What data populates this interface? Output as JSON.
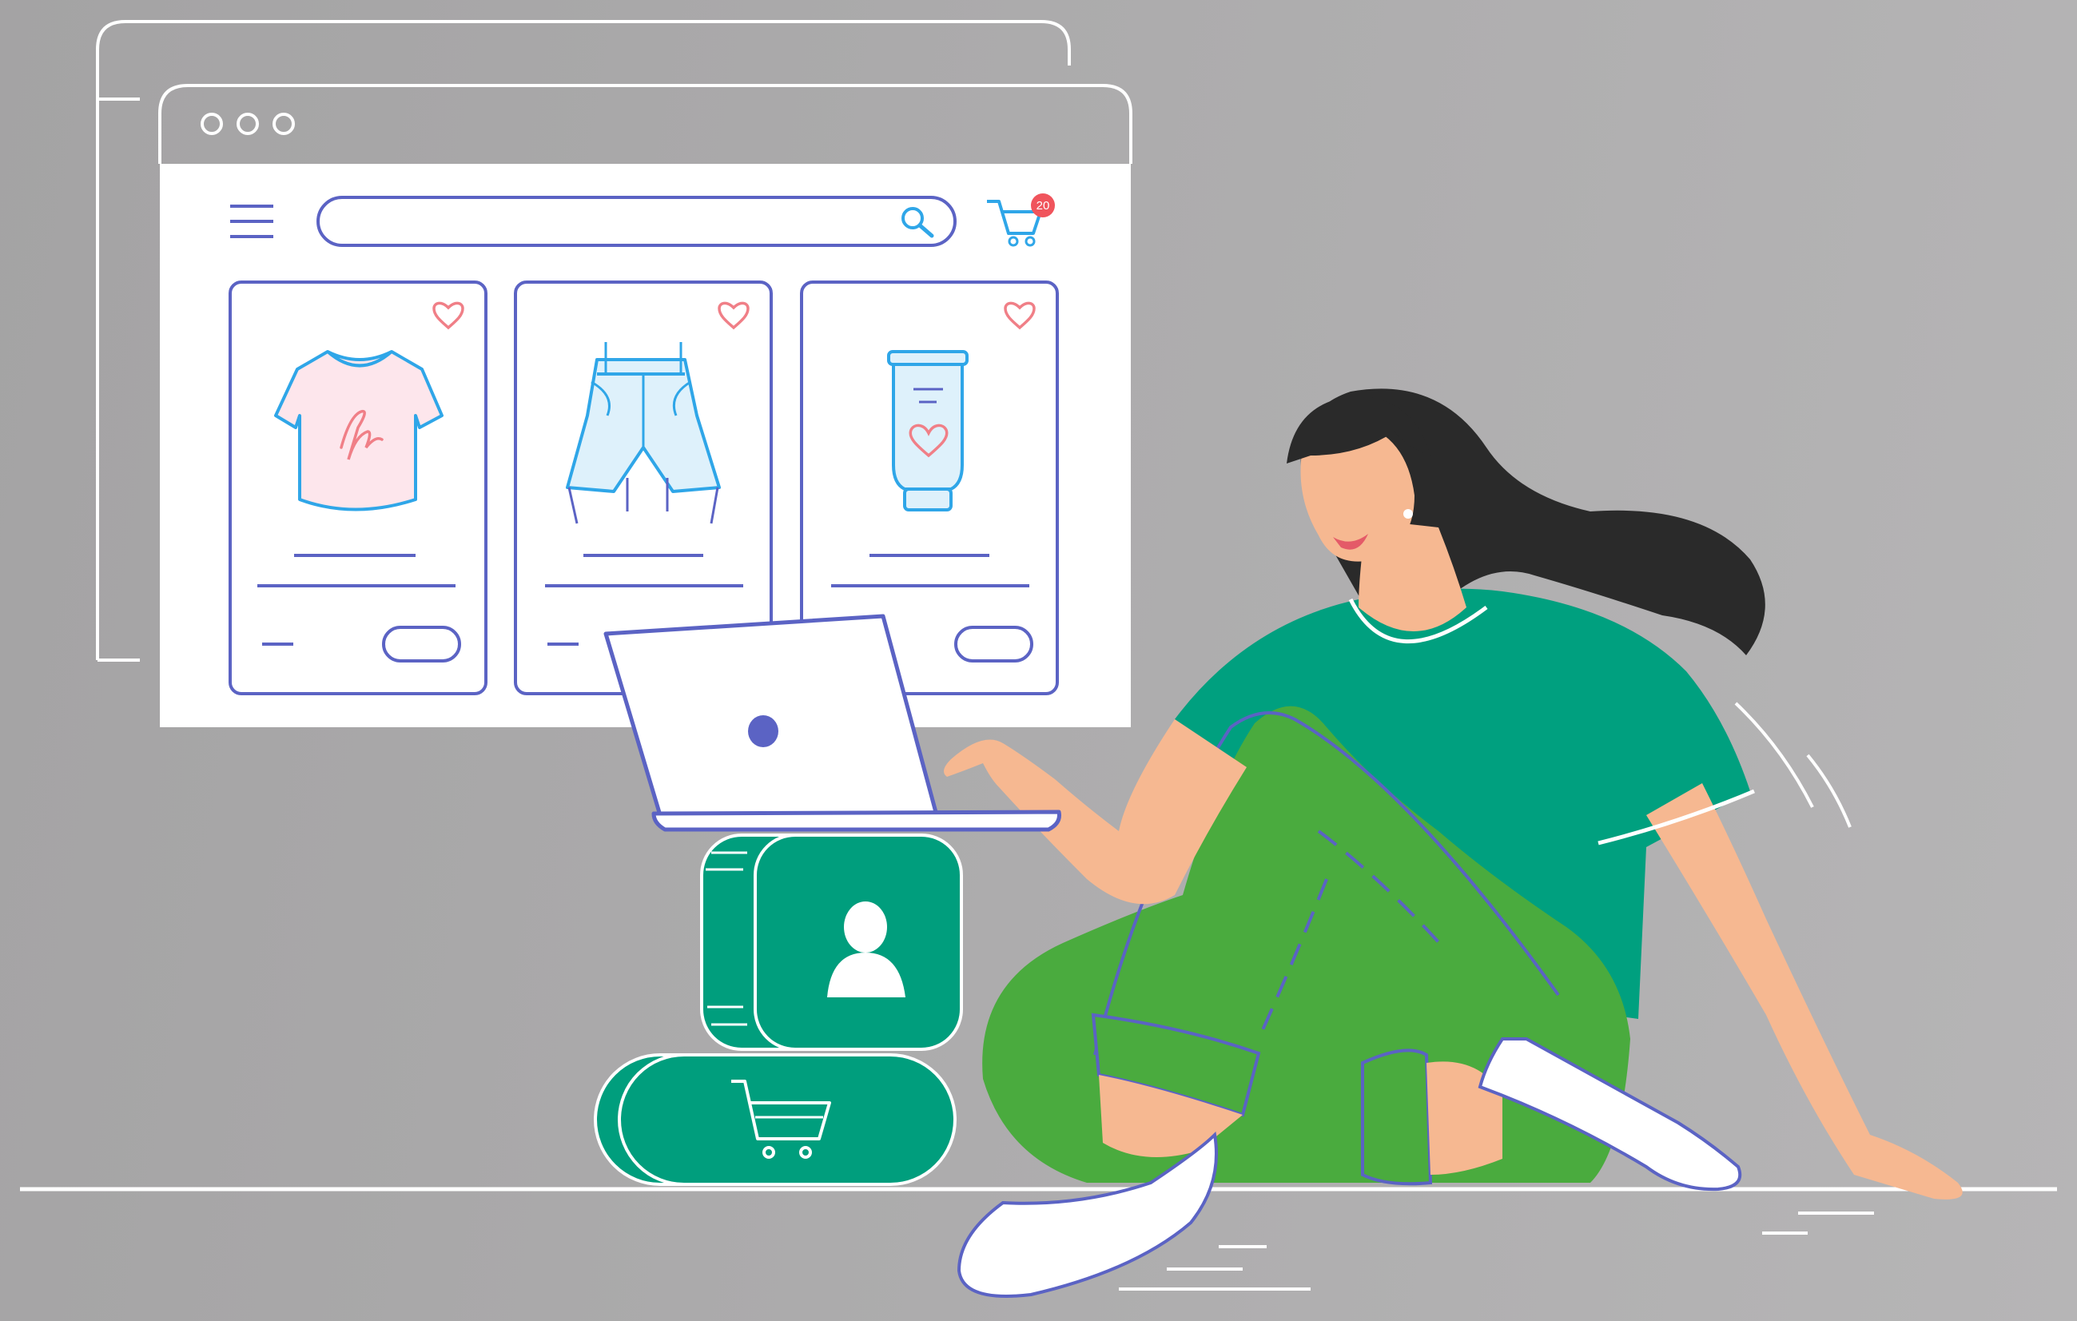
{
  "browser": {
    "cart": {
      "badge_count": "20"
    },
    "products": [
      {
        "name": "t-shirt"
      },
      {
        "name": "shorts"
      },
      {
        "name": "cream-tube"
      }
    ]
  },
  "colors": {
    "background": "#acabac",
    "window": "#ffffff",
    "outline": "#5b63c4",
    "accent_blue": "#2fa6e8",
    "heart": "#f07f87",
    "badge": "#f0545c",
    "green_block": "#009e7d",
    "shirt": "#00a07f",
    "pants": "#4aab3e",
    "skin": "#f6b891",
    "hair": "#2a2a2a"
  },
  "icons": [
    "hamburger-menu-icon",
    "search-icon",
    "cart-icon",
    "heart-icon",
    "user-icon",
    "cart-icon"
  ]
}
